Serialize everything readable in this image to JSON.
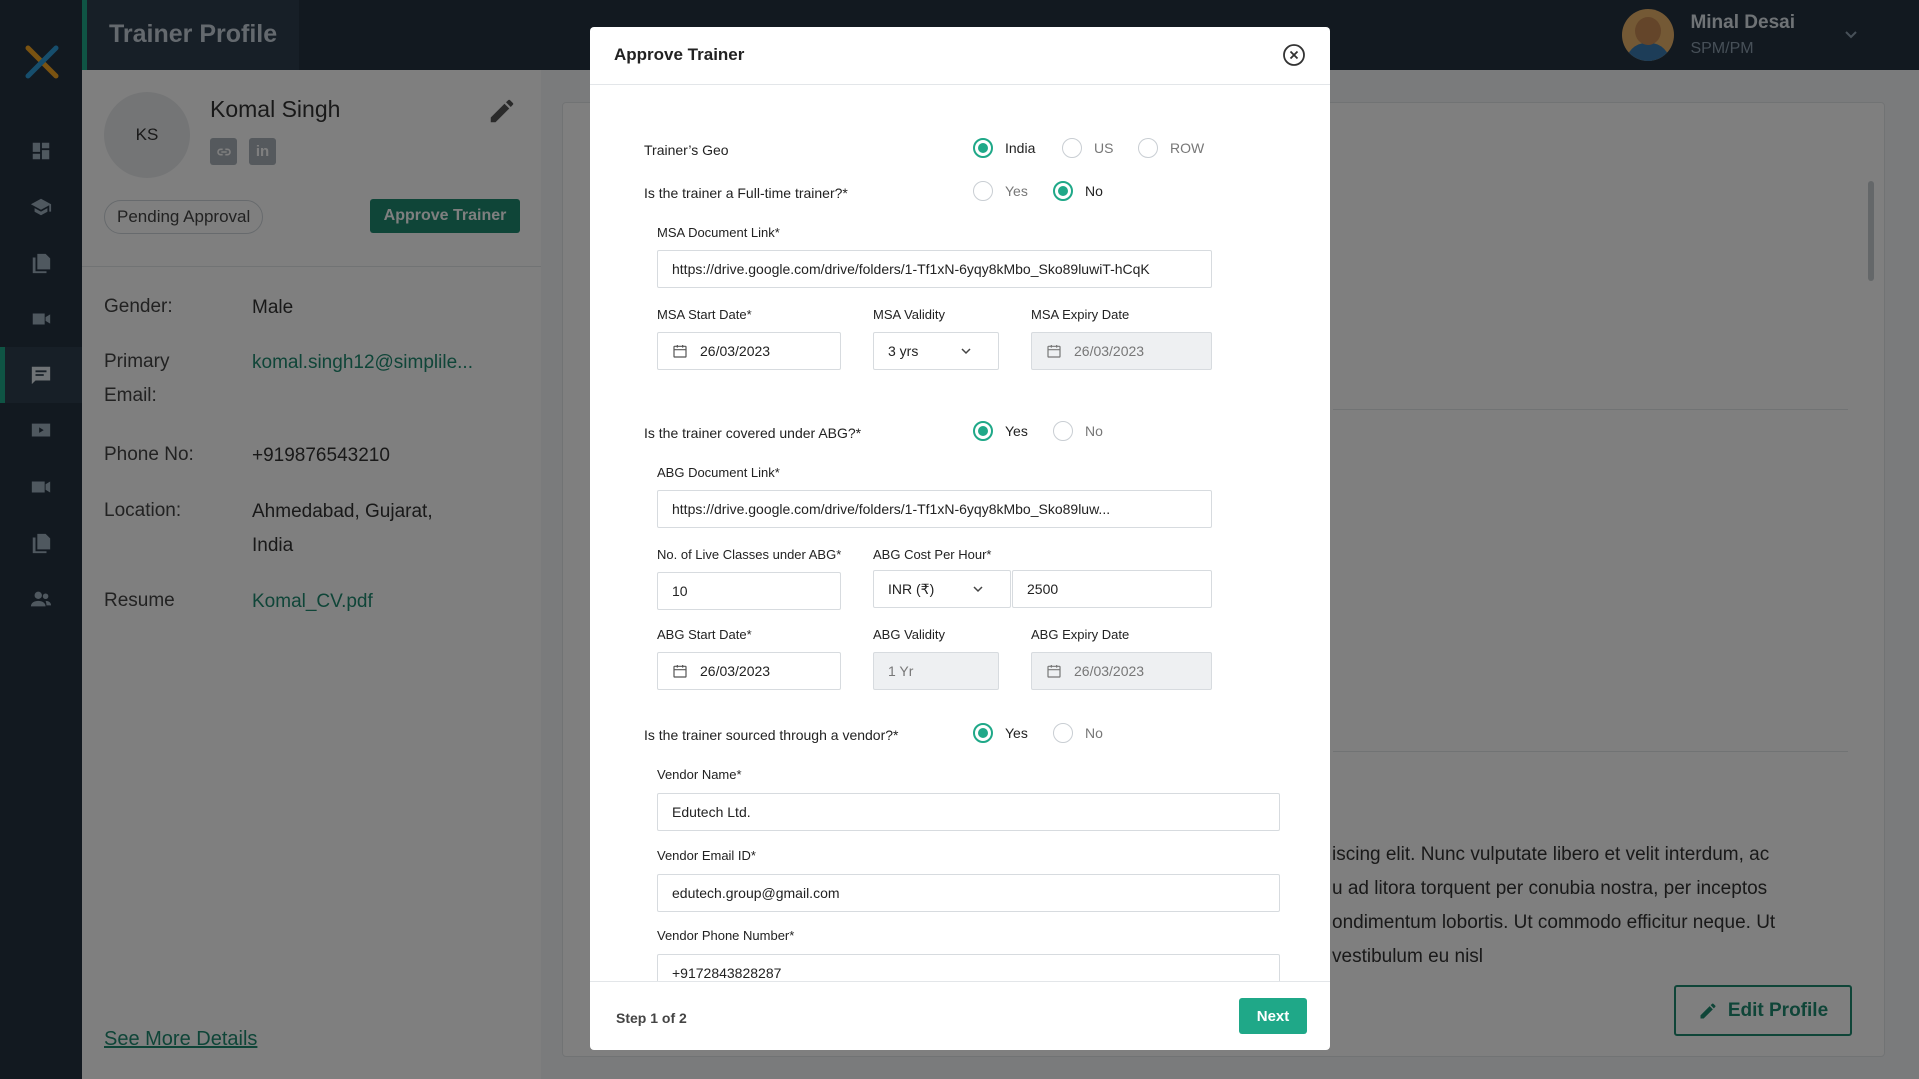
{
  "header": {
    "title": "Trainer Profile",
    "user_name": "Minal Desai",
    "user_role": "SPM/PM"
  },
  "nav": {
    "items": [
      "dashboard-icon",
      "courses-icon",
      "documents-icon",
      "video-icon",
      "feedback-icon",
      "recordings-icon",
      "media-icon",
      "files-icon",
      "users-icon"
    ],
    "active_index": 4
  },
  "profile": {
    "initials": "KS",
    "name": "Komal Singh",
    "social": {
      "link_icon": "link-icon",
      "linkedin": "in"
    },
    "status": "Pending Approval",
    "approve_label": "Approve Trainer",
    "gender_label": "Gender:",
    "gender": "Male",
    "email_label_1": "Primary",
    "email_label_2": "Email:",
    "email": "komal.singh12@simplile...",
    "phone_label": "Phone No:",
    "phone": "+919876543210",
    "location_label": "Location:",
    "location_1": "Ahmedabad, Gujarat,",
    "location_2": "India",
    "resume_label": "Resume",
    "resume": "Komal_CV.pdf",
    "see_more": "See More Details"
  },
  "main": {
    "lorem_1": "iscing elit. Nunc vulputate libero et velit interdum, ac",
    "lorem_2": "u ad litora torquent per conubia nostra, per inceptos",
    "lorem_3": "ondimentum lobortis. Ut commodo efficitur neque. Ut",
    "lorem_4": "vestibulum eu nisl",
    "edit_profile": "Edit Profile"
  },
  "modal": {
    "title": "Approve Trainer",
    "geo": {
      "question": "Trainer’s Geo",
      "options": [
        "India",
        "US",
        "ROW"
      ],
      "selected": "India"
    },
    "fulltime": {
      "question": "Is the trainer a Full-time trainer?*",
      "options": [
        "Yes",
        "No"
      ],
      "selected": "No"
    },
    "msa": {
      "doc_label": "MSA Document Link*",
      "doc_value": "https://drive.google.com/drive/folders/1-Tf1xN-6yqy8kMbo_Sko89luwiT-hCqK",
      "start_label": "MSA Start Date*",
      "start_value": "26/03/2023",
      "validity_label": "MSA Validity",
      "validity_value": "3 yrs",
      "expiry_label": "MSA Expiry Date",
      "expiry_value": "26/03/2023"
    },
    "abg_q": {
      "question": "Is the trainer covered under ABG?*",
      "options": [
        "Yes",
        "No"
      ],
      "selected": "Yes"
    },
    "abg": {
      "doc_label": "ABG Document Link*",
      "doc_value": "https://drive.google.com/drive/folders/1-Tf1xN-6yqy8kMbo_Sko89luw...",
      "classes_label": "No. of Live Classes under ABG*",
      "classes_value": "10",
      "cost_label": "ABG Cost Per Hour*",
      "currency": "INR  (₹)",
      "cost_value": "2500",
      "start_label": "ABG Start Date*",
      "start_value": "26/03/2023",
      "validity_label": "ABG Validity",
      "validity_value": "1 Yr",
      "expiry_label": "ABG Expiry Date",
      "expiry_value": "26/03/2023"
    },
    "vendor_q": {
      "question": "Is the trainer sourced through a vendor?*",
      "options": [
        "Yes",
        "No"
      ],
      "selected": "Yes"
    },
    "vendor": {
      "name_label": "Vendor Name*",
      "name_value": "Edutech Ltd.",
      "email_label": "Vendor Email ID*",
      "email_value": "edutech.group@gmail.com",
      "phone_label": "Vendor Phone Number*",
      "phone_value": "+9172843828287"
    },
    "step": "Step 1 of 2",
    "next": "Next"
  }
}
